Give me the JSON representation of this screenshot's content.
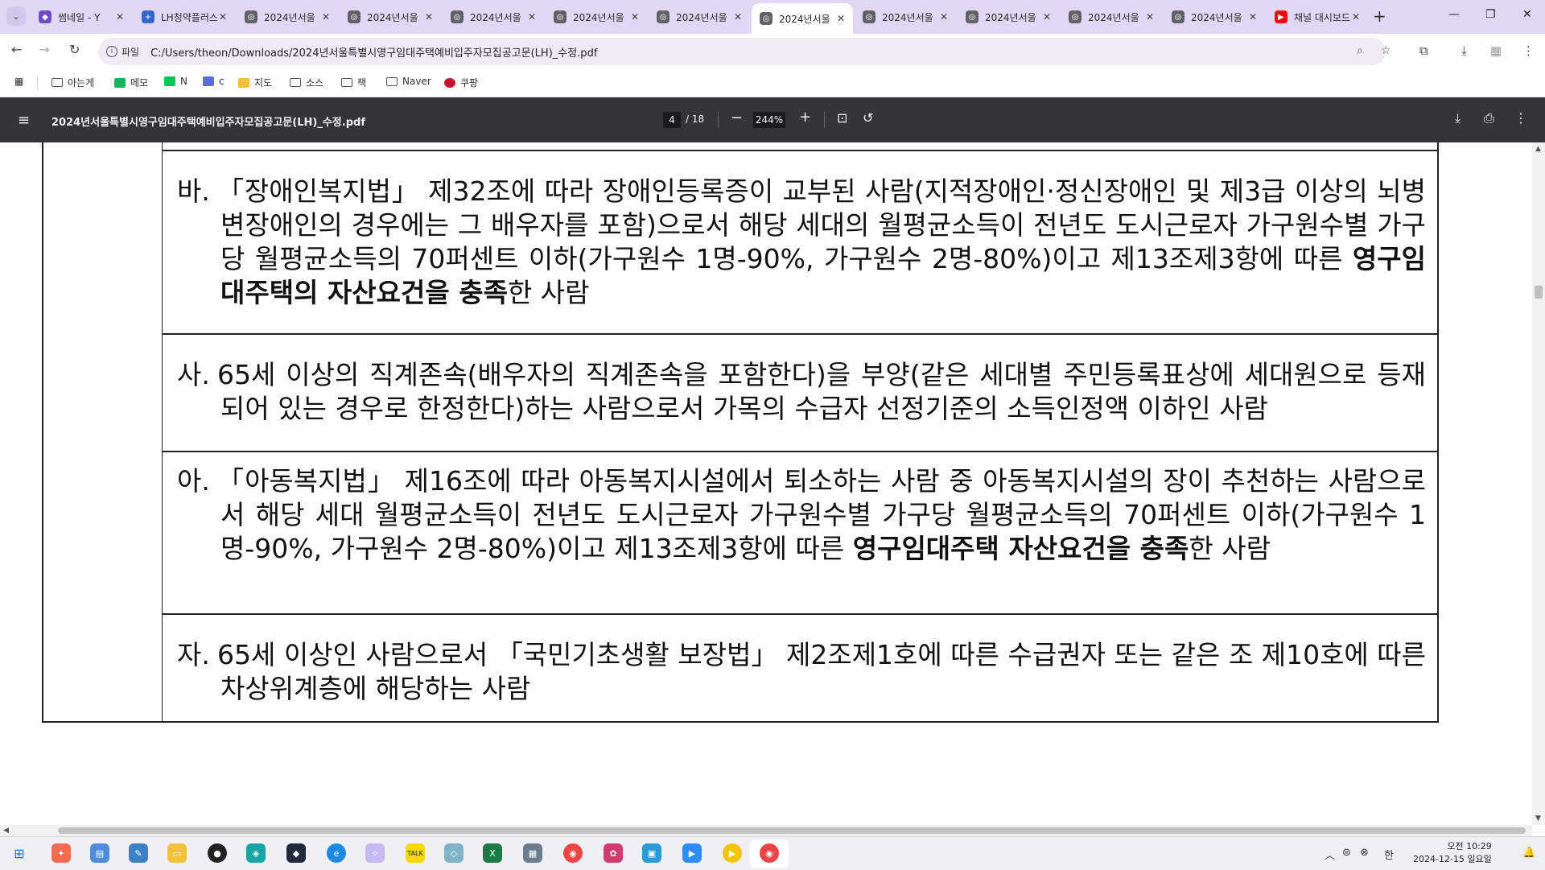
{
  "browser": {
    "tabs": [
      {
        "label": "썸네일 - Y",
        "favicon_color": "#6d4cc2",
        "icon": "shield-icon"
      },
      {
        "label": "LH청약플러스",
        "favicon_color": "#3366cc",
        "icon": "cross-icon"
      },
      {
        "label": "2024년서울",
        "favicon_color": "#5f6368",
        "icon": "globe-icon"
      },
      {
        "label": "2024년서울",
        "favicon_color": "#5f6368",
        "icon": "globe-icon"
      },
      {
        "label": "2024년서울",
        "favicon_color": "#5f6368",
        "icon": "globe-icon"
      },
      {
        "label": "2024년서울",
        "favicon_color": "#5f6368",
        "icon": "globe-icon"
      },
      {
        "label": "2024년서울",
        "favicon_color": "#5f6368",
        "icon": "globe-icon"
      },
      {
        "label": "2024년서울",
        "favicon_color": "#5f6368",
        "icon": "globe-icon",
        "active": true
      },
      {
        "label": "2024년서울",
        "favicon_color": "#5f6368",
        "icon": "globe-icon"
      },
      {
        "label": "2024년서울",
        "favicon_color": "#5f6368",
        "icon": "globe-icon"
      },
      {
        "label": "2024년서울",
        "favicon_color": "#5f6368",
        "icon": "globe-icon"
      },
      {
        "label": "2024년서울",
        "favicon_color": "#5f6368",
        "icon": "globe-icon"
      },
      {
        "label": "채널 대시보드",
        "favicon_color": "#ff0000",
        "icon": "youtube-icon"
      }
    ],
    "url_chip": "파일",
    "url": "C:/Users/theon/Downloads/2024년서울특별시영구임대주택예비입주자모집공고문(LH)_수정.pdf",
    "bookmarks": [
      {
        "label": "아는게",
        "type": "folder"
      },
      {
        "label": "메모",
        "type": "green"
      },
      {
        "label": "N",
        "type": "naver"
      },
      {
        "label": "c",
        "type": "calendar"
      },
      {
        "label": "지도",
        "type": "map"
      },
      {
        "label": "소스",
        "type": "folder"
      },
      {
        "label": "책",
        "type": "folder"
      },
      {
        "label": "Naver",
        "type": "folder"
      },
      {
        "label": "쿠팡",
        "type": "coupang"
      }
    ]
  },
  "pdf": {
    "title": "2024년서울특별시영구임대주택예비입주자모집공고문(LH)_수정.pdf",
    "page_current": "4",
    "page_total": "/ 18",
    "zoom": "244%"
  },
  "document": {
    "items": [
      {
        "marker": "바.",
        "parts": [
          {
            "text": "「장애인복지법」 제32조에 따라 장애인등록증이 교부된 사람(지적장애인·정신장애인 및 제3급 이상의 뇌병변장애인의 경우에는 그 배우자를 포함)으로서 해당 세대의 월평균소득이 전년도 도시근로자 가구원수별 가구당 월평균소득의 70퍼센트 이하(가구원수 1명-90%, 가구원수 2명-80%)이고 제13조제3항에 따른 ",
            "bold": false
          },
          {
            "text": "영구임대주택의 자산요건을 충족",
            "bold": true
          },
          {
            "text": "한 사람",
            "bold": false
          }
        ]
      },
      {
        "marker": "사.",
        "parts": [
          {
            "text": "65세 이상의 직계존속(배우자의 직계존속을 포함한다)을 부양(같은 세대별 주민등록표상에 세대원으로 등재되어 있는 경우로 한정한다)하는 사람으로서 가목의 수급자 선정기준의 소득인정액 이하인 사람",
            "bold": false
          }
        ]
      },
      {
        "marker": "아.",
        "parts": [
          {
            "text": "「아동복지법」 제16조에 따라 아동복지시설에서 퇴소하는 사람 중 아동복지시설의 장이 추천하는 사람으로서 해당 세대 월평균소득이 전년도 도시근로자 가구원수별 가구당 월평균소득의 70퍼센트 이하(가구원수 1명-90%, 가구원수 2명-80%)이고 제13조제3항에 따른 ",
            "bold": false
          },
          {
            "text": "영구임대주택 자산요건을 충족",
            "bold": true
          },
          {
            "text": "한 사람",
            "bold": false
          }
        ]
      },
      {
        "marker": "자.",
        "parts": [
          {
            "text": "65세 이상인 사람으로서 「국민기초생활 보장법」 제2조제1호에 따른 수급권자 또는 같은 조 제10호에 따른 차상위계층에 해당하는 사람",
            "bold": false
          }
        ]
      }
    ]
  },
  "taskbar": {
    "time": "오전 10:29",
    "date": "2024-12-15 일요일",
    "ime": "한"
  }
}
